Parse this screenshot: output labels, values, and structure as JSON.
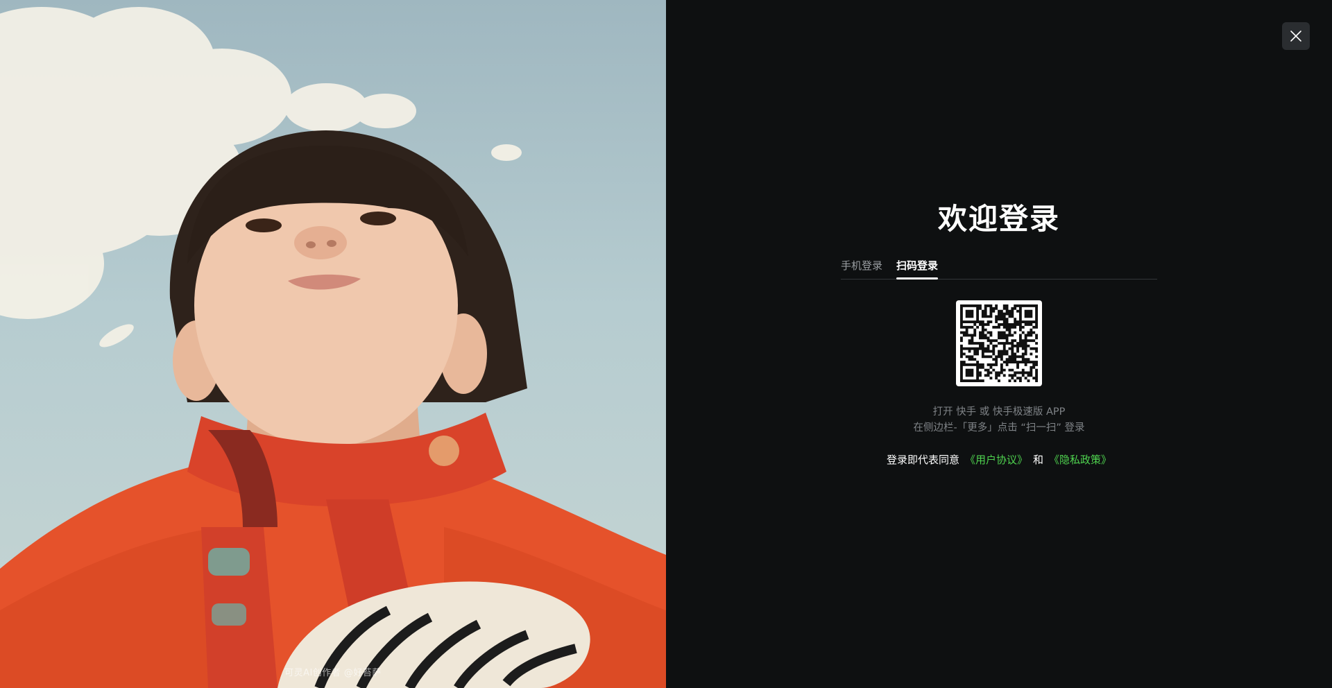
{
  "photo": {
    "credit": "可灵AI创作者 @好苔萨"
  },
  "login": {
    "title": "欢迎登录",
    "tabs": [
      {
        "label": "手机登录",
        "active": false
      },
      {
        "label": "扫码登录",
        "active": true
      }
    ],
    "hint_line1": "打开 快手 或 快手极速版 APP",
    "hint_line2": "在侧边栏-「更多」点击 “扫一扫” 登录",
    "agreement": {
      "prefix": "登录即代表同意",
      "user_agreement": "《用户协议》",
      "conjunction": "和",
      "privacy_policy": "《隐私政策》"
    }
  },
  "icons": {
    "close": "close-icon",
    "qr": "qr-code"
  },
  "colors": {
    "panel_bg": "#0e1011",
    "link": "#4fd34f",
    "close_bg": "#2a2d30"
  }
}
